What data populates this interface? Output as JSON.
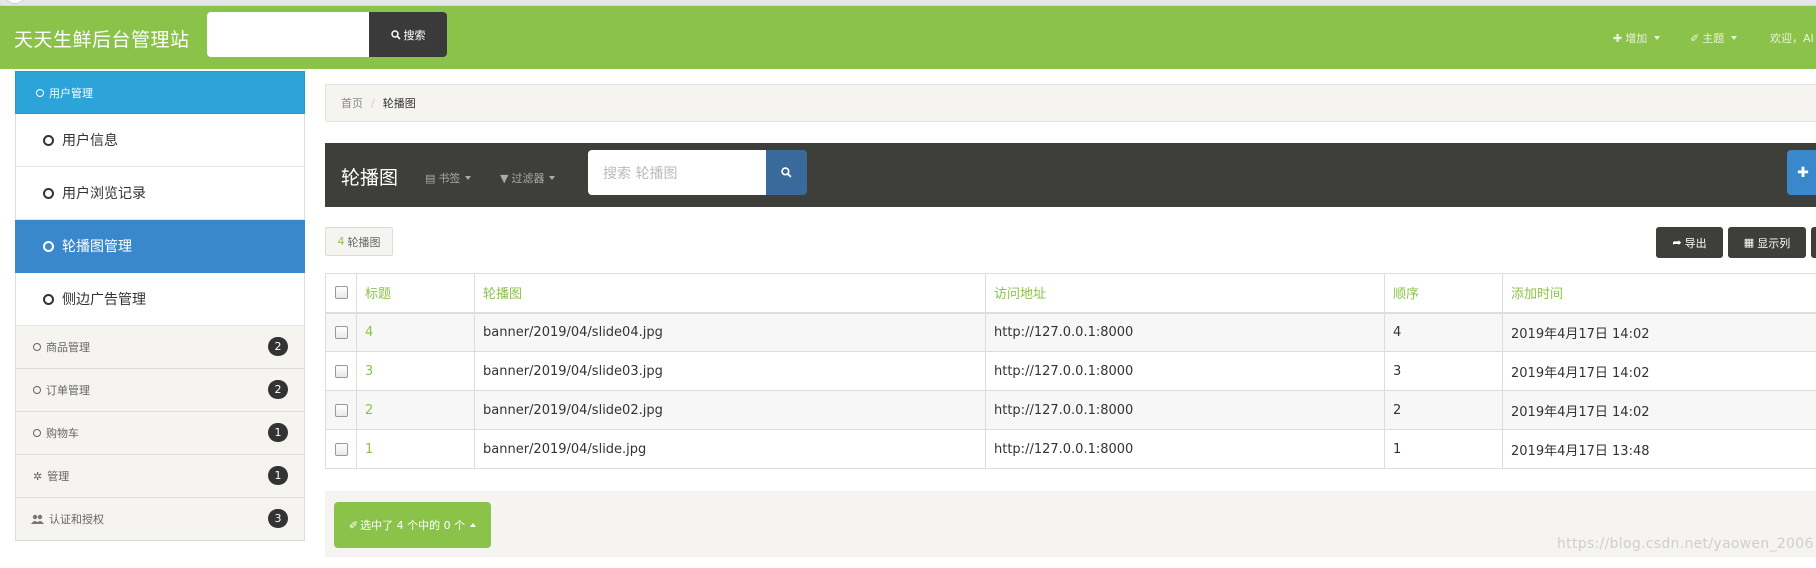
{
  "app": {
    "brand": "天天生鲜后台管理站"
  },
  "navbar": {
    "search_button": "搜索",
    "add": "增加",
    "theme": "主题",
    "welcome": "欢迎，AI"
  },
  "sidebar": {
    "head": "用户管理",
    "sub_items": [
      {
        "label": "用户信息"
      },
      {
        "label": "用户浏览记录"
      },
      {
        "label": "轮播图管理"
      },
      {
        "label": "侧边广告管理"
      }
    ],
    "groups": [
      {
        "label": "商品管理",
        "badge": "2",
        "icon": "circle-icon"
      },
      {
        "label": "订单管理",
        "badge": "2",
        "icon": "circle-icon"
      },
      {
        "label": "购物车",
        "badge": "1",
        "icon": "circle-icon"
      },
      {
        "label": "管理",
        "badge": "1",
        "icon": "gear-icon"
      },
      {
        "label": "认证和授权",
        "badge": "3",
        "icon": "users-icon"
      }
    ]
  },
  "breadcrumb": {
    "home": "首页",
    "current": "轮播图"
  },
  "toolbar": {
    "title": "轮播图",
    "bookmarks": "书签",
    "filters": "过滤器",
    "search_placeholder": "搜索 轮播图"
  },
  "count": {
    "number": "4",
    "label": "轮播图"
  },
  "actions": {
    "export": "导出",
    "columns": "显示列"
  },
  "table": {
    "headers": [
      "标题",
      "轮播图",
      "访问地址",
      "顺序",
      "添加时间"
    ],
    "rows": [
      {
        "title": "4",
        "image": "banner/2019/04/slide04.jpg",
        "url": "http://127.0.0.1:8000",
        "order": "4",
        "time": "2019年4月17日 14:02"
      },
      {
        "title": "3",
        "image": "banner/2019/04/slide03.jpg",
        "url": "http://127.0.0.1:8000",
        "order": "3",
        "time": "2019年4月17日 14:02"
      },
      {
        "title": "2",
        "image": "banner/2019/04/slide02.jpg",
        "url": "http://127.0.0.1:8000",
        "order": "2",
        "time": "2019年4月17日 14:02"
      },
      {
        "title": "1",
        "image": "banner/2019/04/slide.jpg",
        "url": "http://127.0.0.1:8000",
        "order": "1",
        "time": "2019年4月17日 13:48"
      }
    ]
  },
  "footer": {
    "selected": "选中了 4 个中的 0 个"
  },
  "watermark": "https://blog.csdn.net/yaowen_2006",
  "colors": {
    "accent": "#8bc34a",
    "sidebar_head": "#2ca3d9",
    "sidebar_active": "#3a88cc",
    "dark": "#3e3e3b"
  }
}
